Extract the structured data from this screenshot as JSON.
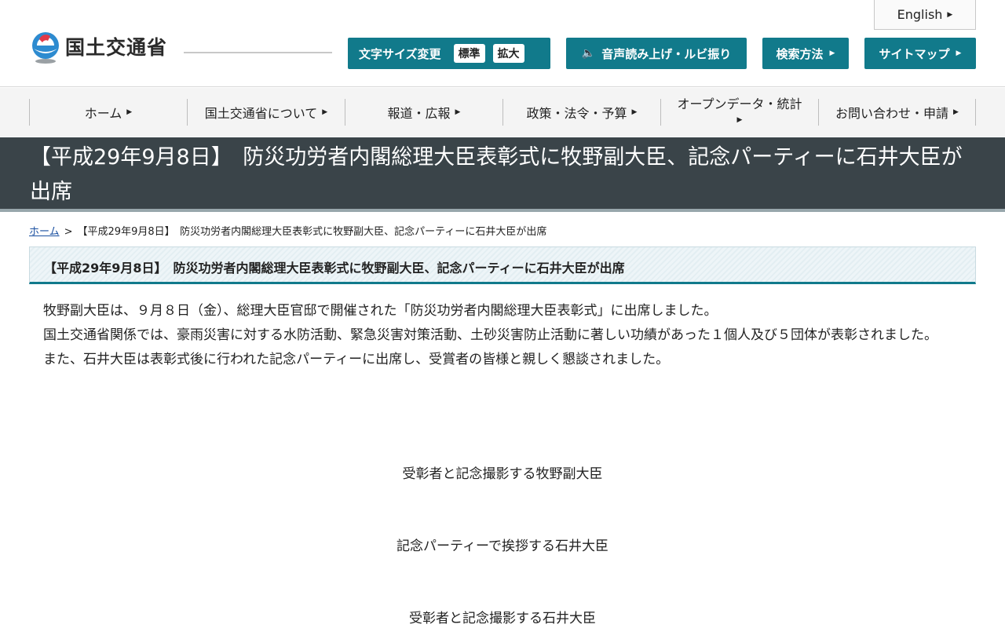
{
  "header": {
    "logo_text": "国土交通省",
    "english_label": "English",
    "fontsize_label": "文字サイズ変更",
    "fontsize_standard": "標準",
    "fontsize_large": "拡大",
    "speech_label": "音声読み上げ・ルビ振り",
    "search_label": "検索方法",
    "sitemap_label": "サイトマップ"
  },
  "nav": {
    "items": [
      {
        "label": "ホーム"
      },
      {
        "label": "国土交通省について"
      },
      {
        "label": "報道・広報"
      },
      {
        "label": "政策・法令・予算"
      },
      {
        "label": "オープンデータ・統計"
      },
      {
        "label": "お問い合わせ・申請"
      }
    ]
  },
  "page": {
    "title": "【平成29年9月8日】　防災功労者内閣総理大臣表彰式に牧野副大臣、記念パーティーに石井大臣が出席",
    "breadcrumb_home": "ホーム",
    "breadcrumb_sep": ">",
    "breadcrumb_current": "【平成29年9月8日】　防災功労者内閣総理大臣表彰式に牧野副大臣、記念パーティーに石井大臣が出席",
    "section_title": "【平成29年9月8日】　防災功労者内閣総理大臣表彰式に牧野副大臣、記念パーティーに石井大臣が出席",
    "paragraphs": [
      "牧野副大臣は、９月８日（金）、総理大臣官邸で開催された「防災功労者内閣総理大臣表彰式」に出席しました。",
      "国土交通省関係では、豪雨災害に対する水防活動、緊急災害対策活動、土砂災害防止活動に著しい功績があった１個人及び５団体が表彰されました。",
      "また、石井大臣は表彰式後に行われた記念パーティーに出席し、受賞者の皆様と親しく懇談されました。"
    ],
    "captions": [
      "受彰者と記念撮影する牧野副大臣",
      "記念パーティーで挨拶する石井大臣",
      "受彰者と記念撮影する石井大臣"
    ]
  },
  "colors": {
    "accent": "#117a8b",
    "title_band": "#3a4449"
  }
}
